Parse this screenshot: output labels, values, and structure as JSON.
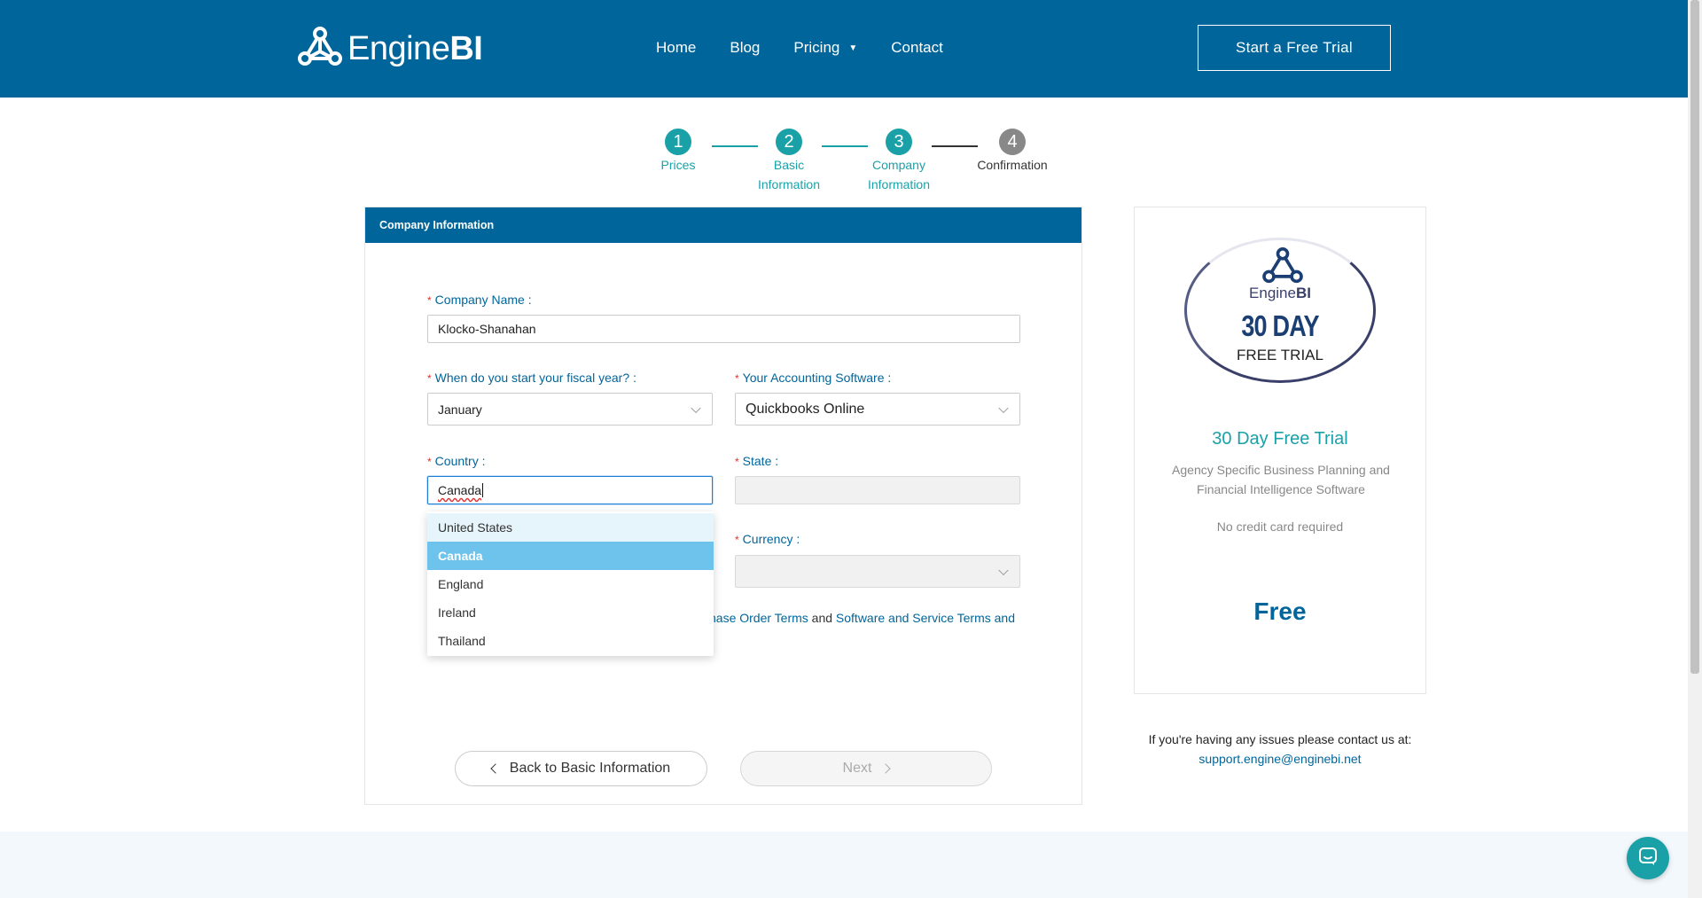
{
  "header": {
    "logo": {
      "light": "Engine",
      "bold": "BI"
    },
    "nav": [
      {
        "label": "Home"
      },
      {
        "label": "Blog"
      },
      {
        "label": "Pricing"
      },
      {
        "label": "Contact"
      }
    ],
    "cta_label": "Start a Free Trial",
    "brand_color": "#00659b"
  },
  "stepper": {
    "steps": [
      {
        "number": "1",
        "label": "Prices",
        "state": "complete"
      },
      {
        "number": "2",
        "label": "Basic Information",
        "state": "complete"
      },
      {
        "number": "3",
        "label": "Company Information",
        "state": "current"
      },
      {
        "number": "4",
        "label": "Confirmation",
        "state": "pending"
      }
    ],
    "active_color": "#1aa1a8",
    "inactive_color": "#888888"
  },
  "form": {
    "section_title": "Company Information",
    "company_name": {
      "label": "Company Name",
      "value": "Klocko-Shanahan"
    },
    "fiscal_year": {
      "label": "When do you start your fiscal year?",
      "value": "January"
    },
    "accounting_software": {
      "label": "Your Accounting Software",
      "value": "Quickbooks Online"
    },
    "country": {
      "label": "Country",
      "value": "Canada"
    },
    "state": {
      "label": "State",
      "value": ""
    },
    "currency": {
      "label": "Currency",
      "value": ""
    },
    "country_options": [
      "United States",
      "Canada",
      "England",
      "Ireland",
      "Thailand"
    ],
    "country_selected": "Canada",
    "terms": {
      "link1": "hase Order Terms",
      "and": "and",
      "link2": "Software and Service Terms and"
    },
    "back_label": "Back to Basic Information",
    "next_label": "Next",
    "required_mark": "*"
  },
  "sidebar": {
    "badge_brand_light": "Engine",
    "badge_brand_bold": "BI",
    "badge_days": "30 DAY",
    "badge_free": "FREE TRIAL",
    "title": "30 Day Free Trial",
    "description": "Agency Specific Business Planning and Financial Intelligence Software",
    "no_credit_card": "No credit card required",
    "price": "Free"
  },
  "support": {
    "text": "If you're having any issues please contact us at:",
    "email": "support.engine@enginebi.net"
  },
  "icons": {
    "logo": "enginebi-logo-icon",
    "chat": "chat-bubble-icon",
    "select": "chevron-down-icon",
    "back": "chevron-left-icon",
    "next": "chevron-right-icon"
  }
}
